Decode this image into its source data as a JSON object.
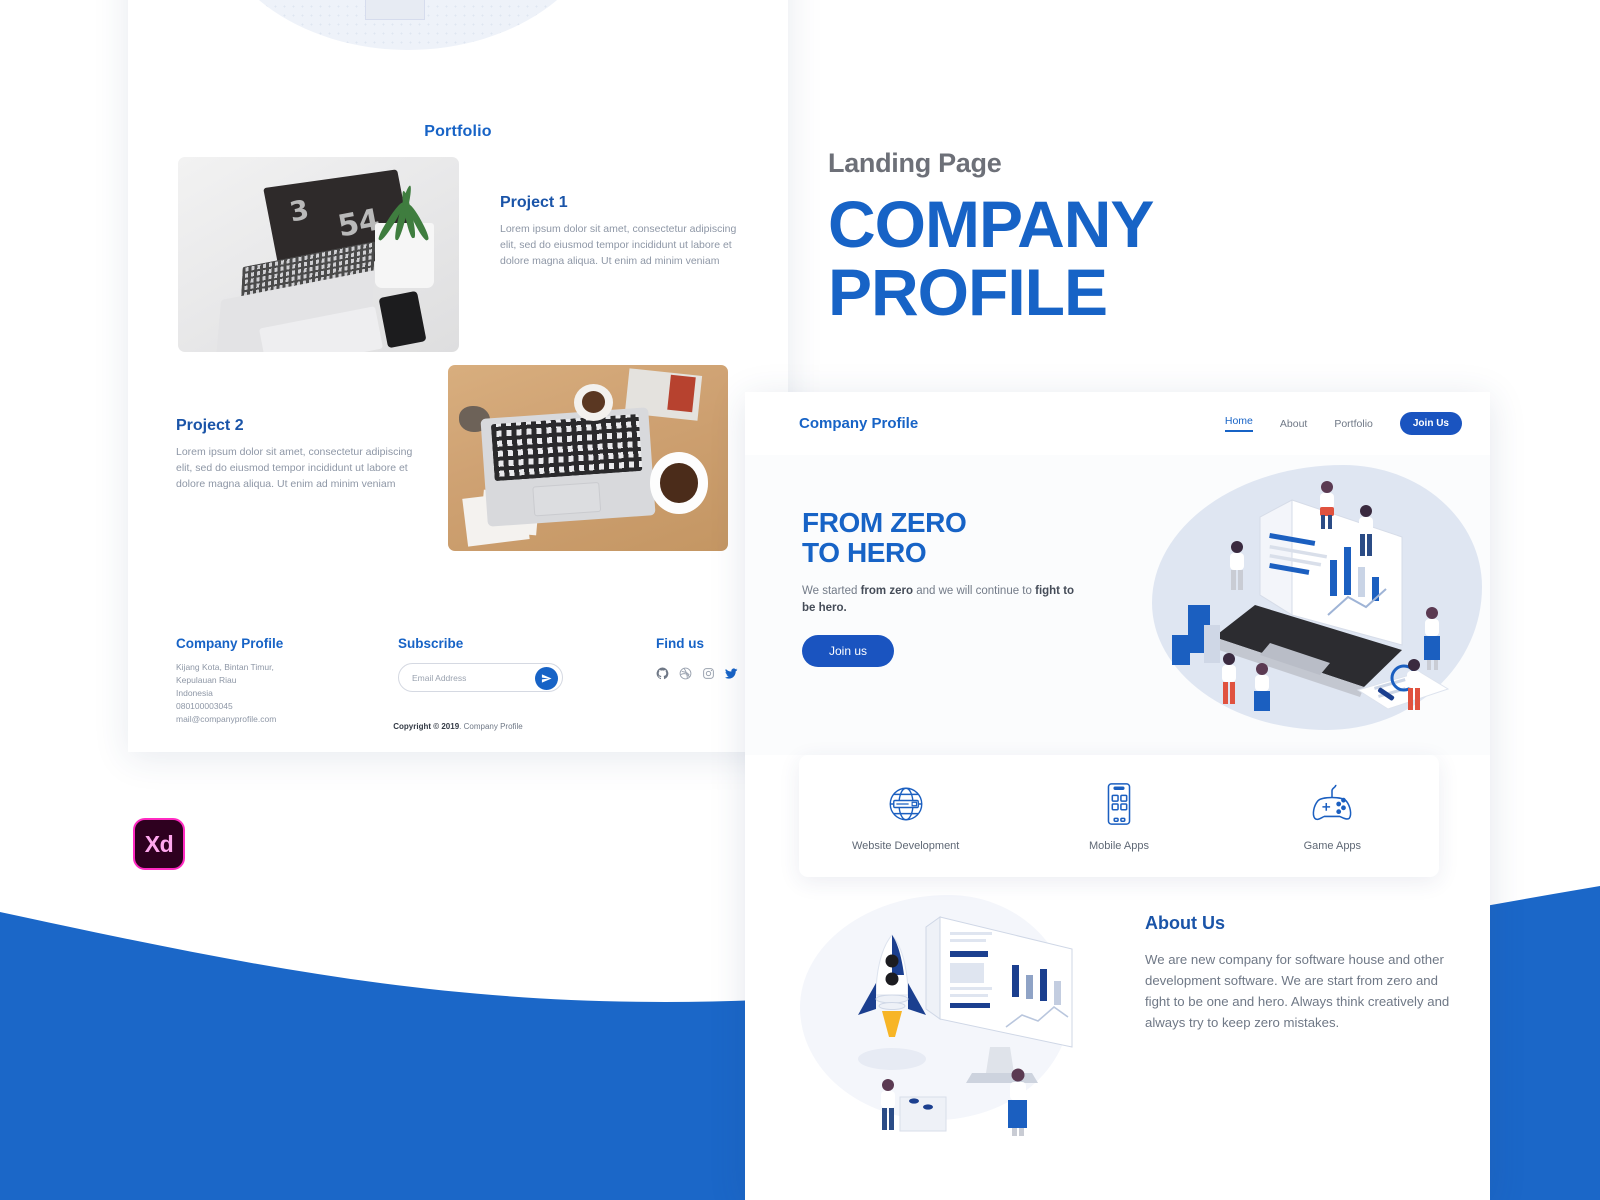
{
  "title_block": {
    "superscript": "Landing Page",
    "line1": "COMPANY",
    "line2": "PROFILE"
  },
  "colors": {
    "brand_blue": "#1763c6",
    "deep_blue": "#1a54c0",
    "wave_blue": "#1b67c8",
    "text_gray": "#6f7886",
    "heading_gray": "#6d7078",
    "blob_blue": "#dfe6f2",
    "xd_magenta": "#ff2bc2",
    "xd_dark": "#2e001f"
  },
  "xd_badge": {
    "label": "Xd",
    "name": "Adobe XD"
  },
  "left_mockup": {
    "portfolio_heading": "Portfolio",
    "projects": [
      {
        "title": "Project 1",
        "description": "Lorem ipsum dolor sit amet, consectetur adipiscing elit, sed do eiusmod tempor incididunt ut labore et dolore magna aliqua. Ut enim ad minim veniam",
        "image_alt": "laptop-plant-desk-photo"
      },
      {
        "title": "Project 2",
        "description": "Lorem ipsum dolor sit amet, consectetur adipiscing elit, sed do eiusmod tempor incididunt ut labore et dolore magna aliqua. Ut enim ad minim veniam",
        "image_alt": "laptop-coffee-wood-desk-photo"
      }
    ],
    "footer": {
      "company_heading": "Company Profile",
      "address_line1": "Kijang Kota, Bintan Timur, Kepulauan Riau",
      "address_line2": "Indonesia",
      "phone": "080100003045",
      "email": "mail@companyprofile.com",
      "subscribe_heading": "Subscribe",
      "email_placeholder": "Email Address",
      "email_value": "",
      "send_icon": "paper-plane-icon",
      "find_us_heading": "Find us",
      "social": [
        {
          "name": "github-icon"
        },
        {
          "name": "dribbble-icon"
        },
        {
          "name": "instagram-icon"
        },
        {
          "name": "twitter-icon"
        }
      ],
      "copyright_bold": "Copyright © 2019",
      "copyright_rest": ". Company Profile"
    }
  },
  "right_mockup": {
    "nav": {
      "brand": "Company Profile",
      "links": [
        {
          "label": "Home",
          "active": true
        },
        {
          "label": "About",
          "active": false
        },
        {
          "label": "Portfolio",
          "active": false
        }
      ],
      "cta": "Join Us"
    },
    "hero": {
      "title_line1": "FROM ZERO",
      "title_line2": "TO HERO",
      "sub_pre": "We started ",
      "sub_bold1": "from zero",
      "sub_mid": " and we will continue to ",
      "sub_bold2": "fight to be hero.",
      "button": "Join us",
      "illustration": "isometric-laptop-charts-people"
    },
    "services": [
      {
        "label": "Website Development",
        "icon": "globe-icon"
      },
      {
        "label": "Mobile Apps",
        "icon": "smartphone-icon"
      },
      {
        "label": "Game Apps",
        "icon": "gamepad-icon"
      }
    ],
    "about": {
      "heading": "About Us",
      "body": "We are new company for software house and other development software. We are start from zero and fight to be one and hero. Always think creatively and always try to keep zero mistakes.",
      "illustration": "isometric-rocket-monitor"
    }
  }
}
